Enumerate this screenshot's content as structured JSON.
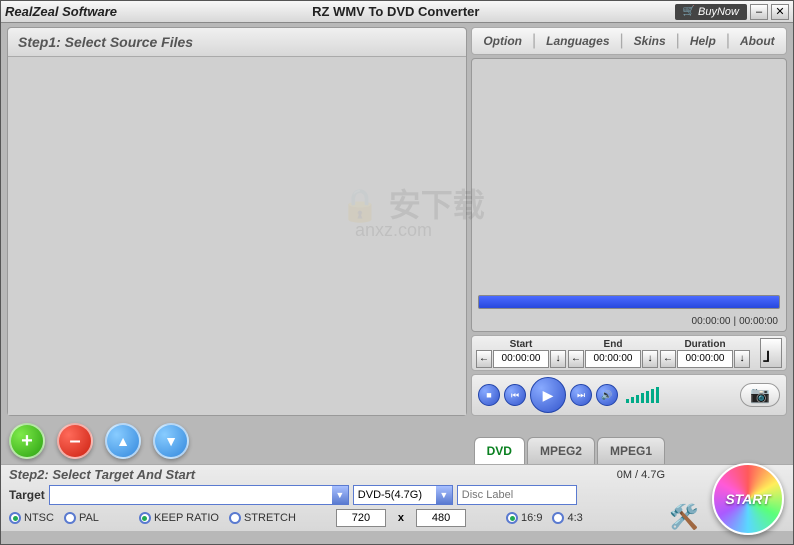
{
  "titlebar": {
    "brand": "RealZeal Software",
    "title": "RZ WMV To DVD Converter",
    "buynow": "BuyNow"
  },
  "menu": {
    "option": "Option",
    "languages": "Languages",
    "skins": "Skins",
    "help": "Help",
    "about": "About"
  },
  "step1": {
    "header": "Step1: Select Source Files"
  },
  "preview": {
    "time_current": "00:00:00",
    "time_total": "00:00:00"
  },
  "trim": {
    "start_label": "Start",
    "start_value": "00:00:00",
    "end_label": "End",
    "end_value": "00:00:00",
    "duration_label": "Duration",
    "duration_value": "00:00:00"
  },
  "tabs": {
    "dvd": "DVD",
    "mpeg2": "MPEG2",
    "mpeg1": "MPEG1"
  },
  "start_btn": "START",
  "step2": {
    "header": "Step2: Select Target And Start",
    "size_info": "0M / 4.7G",
    "target_label": "Target",
    "target_value": "",
    "disc_type": "DVD-5(4.7G)",
    "disc_label_placeholder": "Disc Label"
  },
  "options": {
    "ntsc": "NTSC",
    "pal": "PAL",
    "keep_ratio": "KEEP RATIO",
    "stretch": "STRETCH",
    "width": "720",
    "height": "480",
    "r169": "16:9",
    "r43": "4:3"
  },
  "watermark": {
    "main": "安下载",
    "sub": "anxz.com"
  }
}
